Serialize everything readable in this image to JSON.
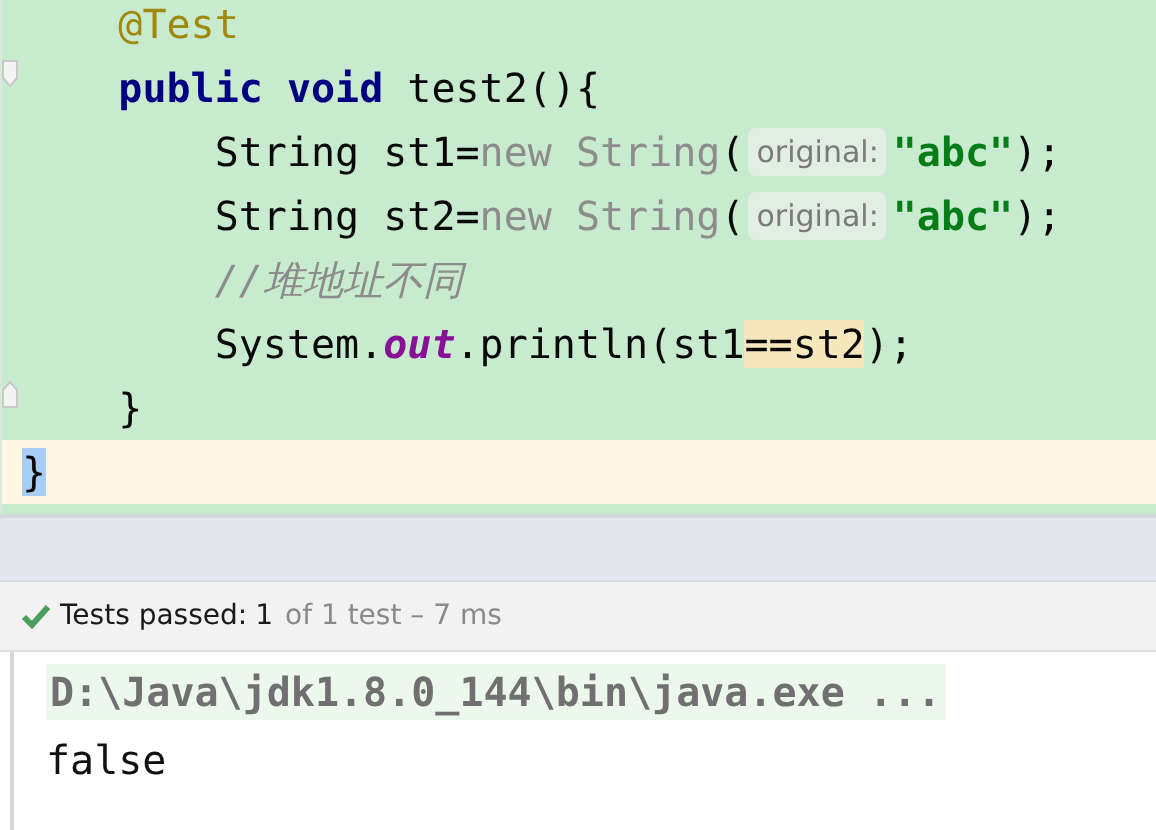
{
  "editor": {
    "lines": [
      {
        "current": false,
        "fold_open": false,
        "fold_close": false,
        "tokens": [
          {
            "kind": "annotation",
            "text": "    @Test"
          }
        ]
      },
      {
        "current": false,
        "fold_open": true,
        "fold_close": false,
        "tokens": [
          {
            "kind": "keyword",
            "text": "    public void"
          },
          {
            "kind": "plain",
            "text": " test2(){"
          }
        ]
      },
      {
        "current": false,
        "fold_open": false,
        "fold_close": false,
        "tokens": [
          {
            "kind": "plain",
            "text": "        String st1="
          },
          {
            "kind": "unused",
            "text": "new String"
          },
          {
            "kind": "plain",
            "text": "("
          },
          {
            "kind": "hint",
            "text": "original:"
          },
          {
            "kind": "string",
            "text": "\"abc\""
          },
          {
            "kind": "plain",
            "text": ");"
          }
        ]
      },
      {
        "current": false,
        "fold_open": false,
        "fold_close": false,
        "tokens": [
          {
            "kind": "plain",
            "text": "        String st2="
          },
          {
            "kind": "unused",
            "text": "new String"
          },
          {
            "kind": "plain",
            "text": "("
          },
          {
            "kind": "hint",
            "text": "original:"
          },
          {
            "kind": "string",
            "text": "\"abc\""
          },
          {
            "kind": "plain",
            "text": ");"
          }
        ]
      },
      {
        "current": false,
        "fold_open": false,
        "fold_close": false,
        "tokens": [
          {
            "kind": "comment",
            "text": "        //堆地址不同"
          }
        ]
      },
      {
        "current": false,
        "fold_open": false,
        "fold_close": false,
        "tokens": [
          {
            "kind": "plain",
            "text": "        System."
          },
          {
            "kind": "static",
            "text": "out"
          },
          {
            "kind": "plain",
            "text": ".println(st1"
          },
          {
            "kind": "usage",
            "text": "==st2"
          },
          {
            "kind": "plain",
            "text": ");"
          }
        ]
      },
      {
        "current": false,
        "fold_open": false,
        "fold_close": true,
        "tokens": [
          {
            "kind": "plain",
            "text": "    }"
          }
        ]
      },
      {
        "current": true,
        "fold_open": false,
        "fold_close": false,
        "tokens": [
          {
            "kind": "brace-match",
            "text": "}"
          }
        ]
      }
    ]
  },
  "test_status": {
    "passed": true,
    "label": "Tests passed:",
    "count": "1",
    "detail": "of 1 test – 7 ms"
  },
  "console": {
    "lines": [
      {
        "kind": "command",
        "text": "D:\\Java\\jdk1.8.0_144\\bin\\java.exe ..."
      },
      {
        "kind": "output",
        "text": "false"
      }
    ]
  }
}
